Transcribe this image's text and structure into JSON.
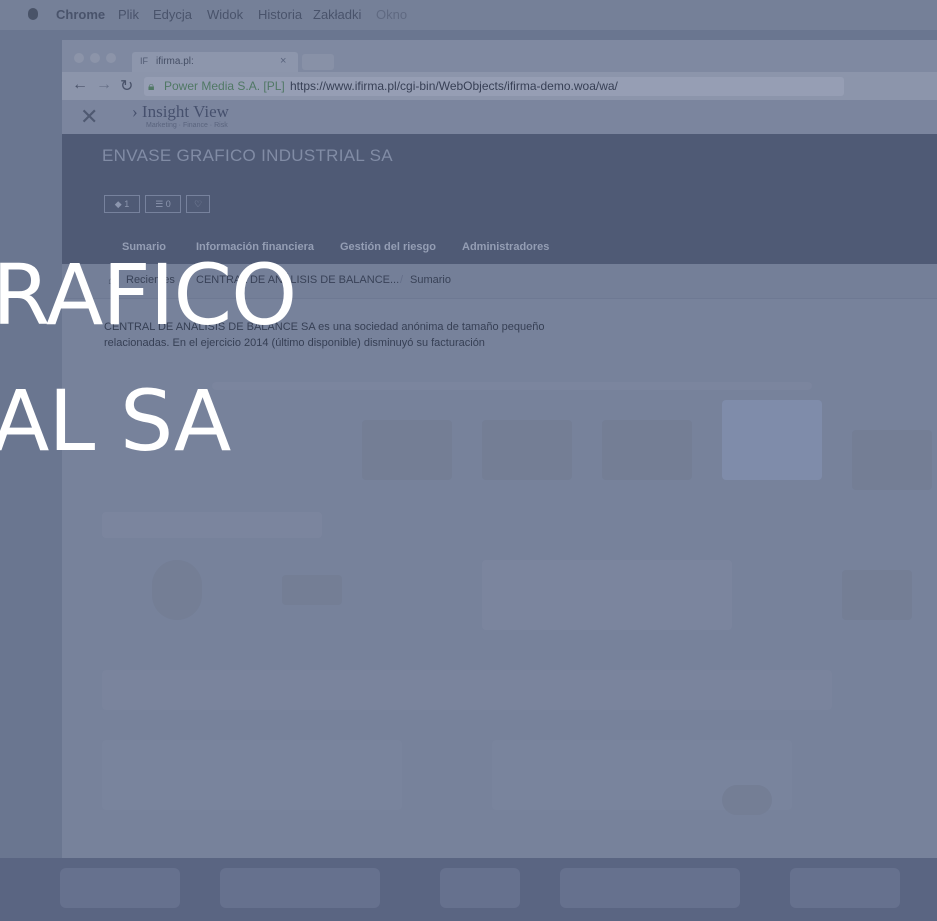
{
  "os_menu": {
    "items": [
      "Chrome",
      "Plik",
      "Edycja",
      "Widok",
      "Historia",
      "Zakładki",
      "Okno"
    ]
  },
  "browser": {
    "tab_title": "ifirma.pl:",
    "tab_favicon": "IF",
    "tab_close": "×",
    "cert_label": "Power Media S.A. [PL]",
    "url": "https://www.ifirma.pl/cgi-bin/WebObjects/ifirma-demo.woa/wa/"
  },
  "app": {
    "brand": "Insight View",
    "tagline": "Marketing · Finance · Risk",
    "company_name": "ENVASE GRAFICO INDUSTRIAL SA",
    "badges": [
      "1",
      "0",
      ""
    ],
    "nav_tabs": [
      "Sumario",
      "Información financiera",
      "Gestión del riesgo",
      "Administradores"
    ],
    "breadcrumb": [
      "Recientes",
      "CENTRAL DE ANÁLISIS DE BALANCE...",
      "Sumario"
    ],
    "description_line1": "CENTRAL DE ANÁLISIS DE BALANCE SA es una sociedad anónima de tamaño pequeño",
    "description_line2": "relacionadas. En el ejercicio 2014 (último disponible) disminuyó su facturación"
  },
  "overlay_title": {
    "line1": "RAFICO",
    "line2": "AL SA"
  },
  "colors": {
    "overlay_tint": "#5c6888",
    "banner": "#4c5670",
    "title_text": "#ffffff"
  }
}
